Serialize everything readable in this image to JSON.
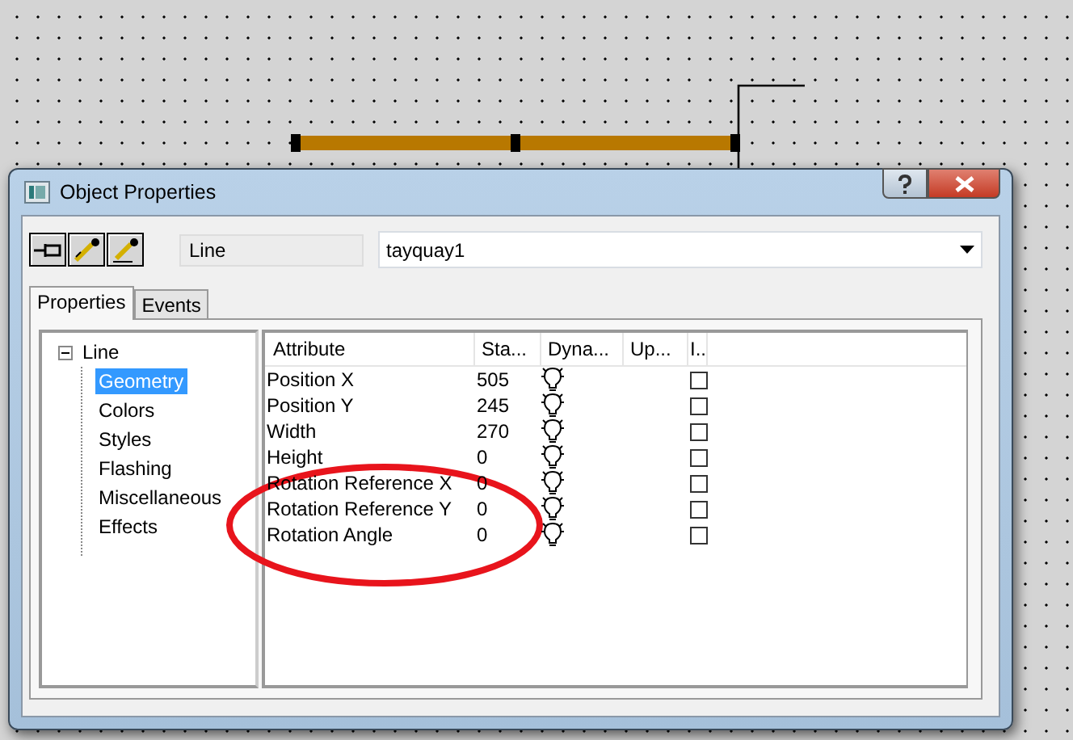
{
  "window": {
    "title": "Object Properties"
  },
  "toolbar": {
    "tools": [
      {
        "kind": "pin"
      },
      {
        "kind": "pick"
      },
      {
        "kind": "pick-edit"
      }
    ],
    "object_type": "Line",
    "object_name": "tayquay1"
  },
  "tabs": [
    {
      "label": "Properties",
      "selected": true
    },
    {
      "label": "Events",
      "selected": false
    }
  ],
  "tree": {
    "label": "Line",
    "expanded": true,
    "children": [
      {
        "label": "Geometry",
        "selected": true
      },
      {
        "label": "Colors",
        "selected": false
      },
      {
        "label": "Styles",
        "selected": false
      },
      {
        "label": "Flashing",
        "selected": false
      },
      {
        "label": "Miscellaneous",
        "selected": false
      },
      {
        "label": "Effects",
        "selected": false
      }
    ]
  },
  "table": {
    "columns": [
      "Attribute",
      "Sta...",
      "Dyna...",
      "Up...",
      "I.."
    ],
    "rows": [
      {
        "attribute": "Position X",
        "static": "505",
        "checked": false
      },
      {
        "attribute": "Position Y",
        "static": "245",
        "checked": false
      },
      {
        "attribute": "Width",
        "static": "270",
        "checked": false
      },
      {
        "attribute": "Height",
        "static": "0",
        "checked": false
      },
      {
        "attribute": "Rotation Reference X",
        "static": "0",
        "checked": false
      },
      {
        "attribute": "Rotation Reference Y",
        "static": "0",
        "checked": false
      },
      {
        "attribute": "Rotation Angle",
        "static": "0",
        "checked": false
      }
    ]
  }
}
